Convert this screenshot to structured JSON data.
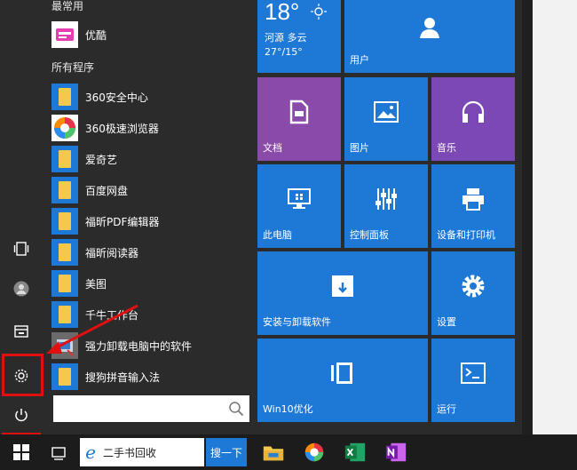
{
  "left_rail": {
    "icons": [
      "task-view-icon",
      "user-icon",
      "documents-icon",
      "settings-icon",
      "power-icon"
    ]
  },
  "app_list": {
    "most_used_header": "最常用",
    "most_used": [
      {
        "label": "优酷",
        "icon": "youku-icon"
      }
    ],
    "all_programs_header": "所有程序",
    "items": [
      {
        "label": "360安全中心"
      },
      {
        "label": "360极速浏览器"
      },
      {
        "label": "爱奇艺"
      },
      {
        "label": "百度网盘"
      },
      {
        "label": "福昕PDF编辑器"
      },
      {
        "label": "福昕阅读器"
      },
      {
        "label": "美图"
      },
      {
        "label": "千牛工作台"
      },
      {
        "label": "强力卸载电脑中的软件"
      },
      {
        "label": "搜狗拼音输入法"
      }
    ],
    "search_placeholder": ""
  },
  "tiles": {
    "weather": {
      "temp": "18°",
      "city": "河源 多云",
      "range": "27°/15°"
    },
    "user": "用户",
    "documents": "文档",
    "pictures": "图片",
    "music": "音乐",
    "this_pc": "此电脑",
    "control_panel": "控制面板",
    "devices_printers": "设备和打印机",
    "install_uninstall": "安装与卸载软件",
    "settings": "设置",
    "win10_optimize": "Win10优化",
    "run": "运行"
  },
  "taskbar": {
    "search_text": "二手书回收",
    "search_button": "搜一下",
    "pinned": [
      "file-explorer-icon",
      "360-browser-icon",
      "excel-icon",
      "onenote-icon"
    ]
  },
  "colors": {
    "tile_blue": "#1e78d6",
    "tile_purple": "#8a4aaa",
    "background": "#2b2b2b",
    "annotation_red": "#e01010"
  }
}
